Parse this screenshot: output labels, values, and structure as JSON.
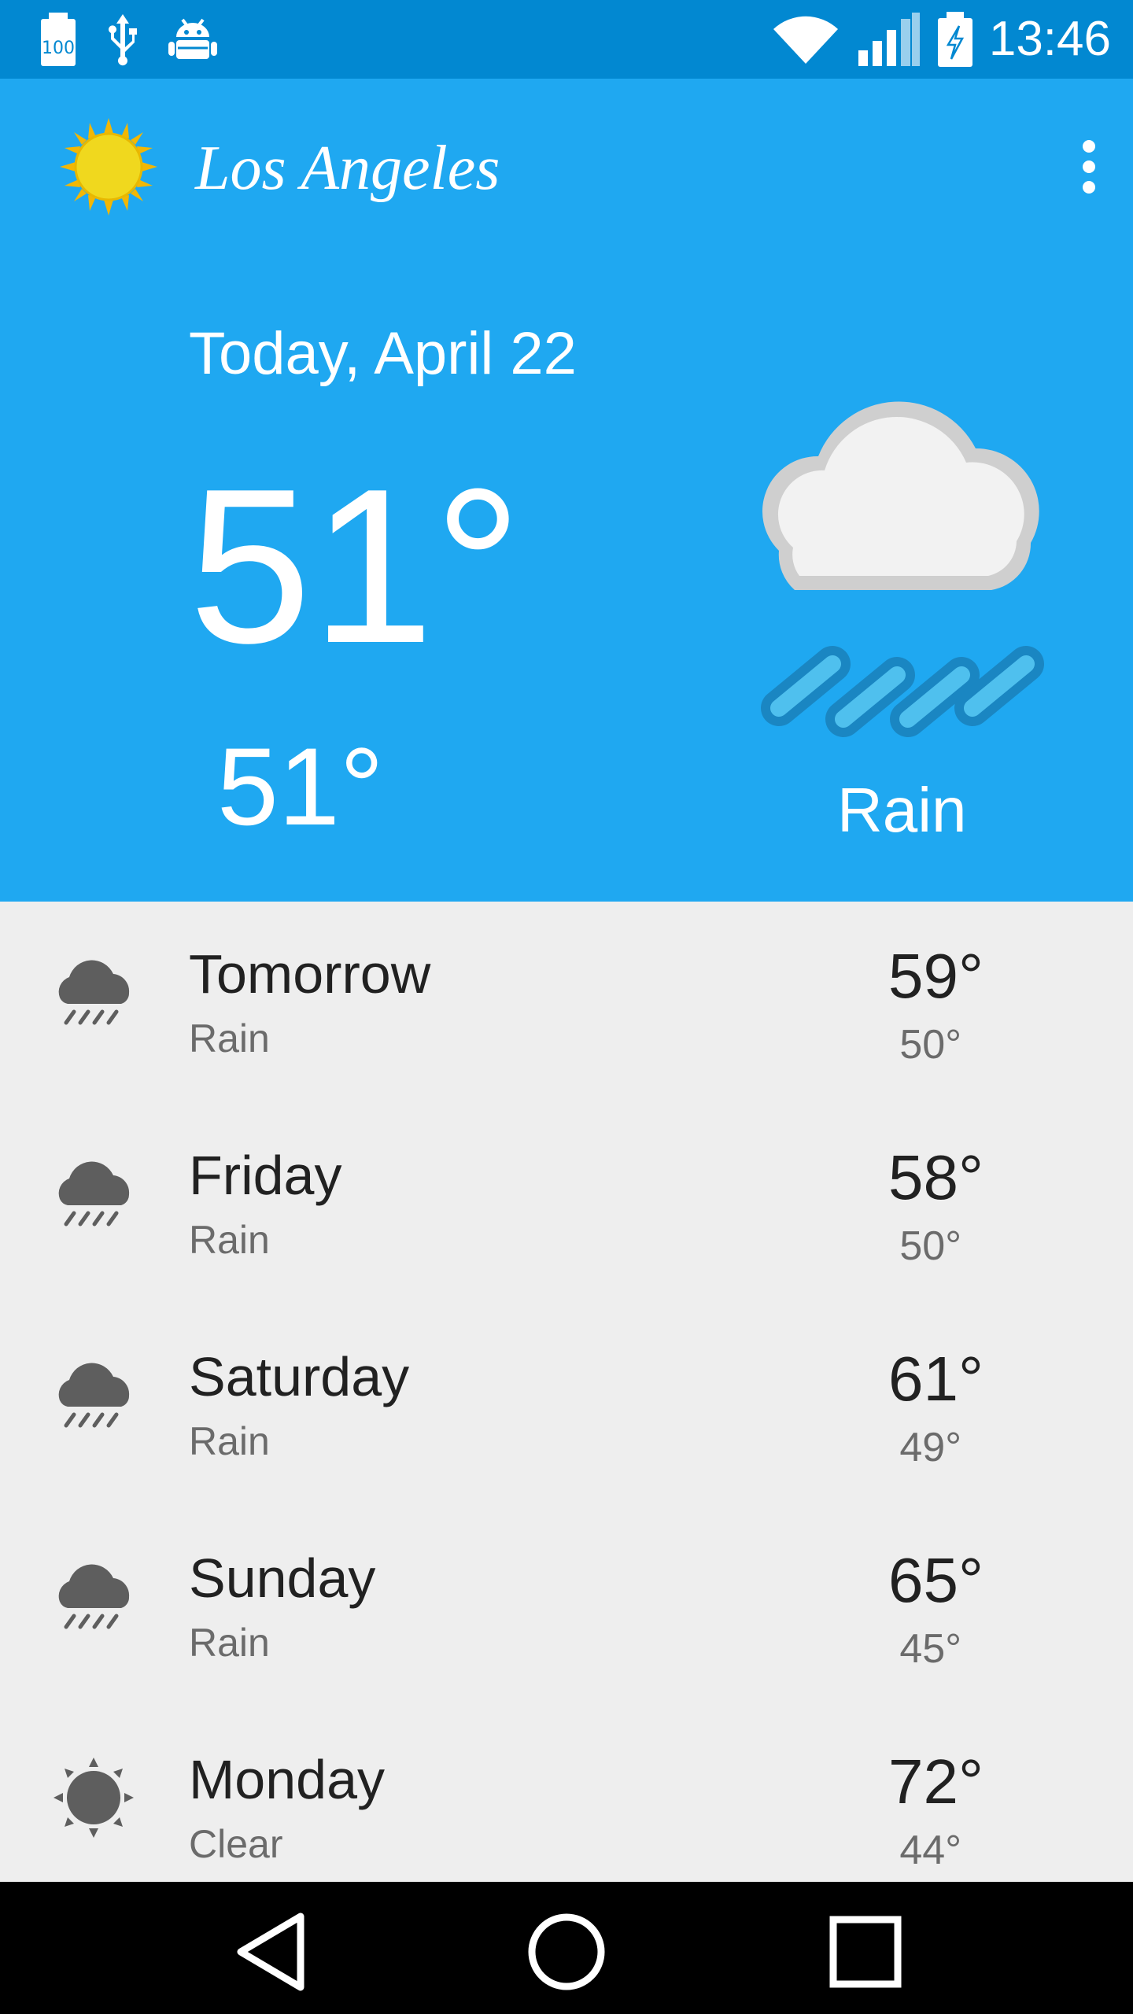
{
  "status_bar": {
    "time": "13:46",
    "left_icons": [
      "battery-100-icon",
      "usb-icon",
      "android-debug-icon"
    ],
    "right_icons": [
      "wifi-icon",
      "signal-icon",
      "battery-charging-icon"
    ]
  },
  "app_bar": {
    "city": "Los Angeles",
    "logo_icon": "sun-logo-icon",
    "menu_icon": "overflow-menu-icon"
  },
  "today": {
    "date": "Today, April 22",
    "high": "51°",
    "low": "51°",
    "description": "Rain",
    "icon": "rain-cloud-icon"
  },
  "forecast": [
    {
      "day": "Tomorrow",
      "description": "Rain",
      "high": "59°",
      "low": "50°",
      "icon": "rain-icon"
    },
    {
      "day": "Friday",
      "description": "Rain",
      "high": "58°",
      "low": "50°",
      "icon": "rain-icon"
    },
    {
      "day": "Saturday",
      "description": "Rain",
      "high": "61°",
      "low": "49°",
      "icon": "rain-icon"
    },
    {
      "day": "Sunday",
      "description": "Rain",
      "high": "65°",
      "low": "45°",
      "icon": "rain-icon"
    },
    {
      "day": "Monday",
      "description": "Clear",
      "high": "72°",
      "low": "44°",
      "icon": "clear-sun-icon"
    }
  ],
  "nav_bar": {
    "buttons": [
      "back-button",
      "home-button",
      "recents-button"
    ]
  },
  "colors": {
    "status_bar": "#0288d1",
    "header": "#1fa8f1",
    "list_background": "#eeeeee",
    "primary_text": "#212121",
    "secondary_text": "#6b6b6b"
  }
}
